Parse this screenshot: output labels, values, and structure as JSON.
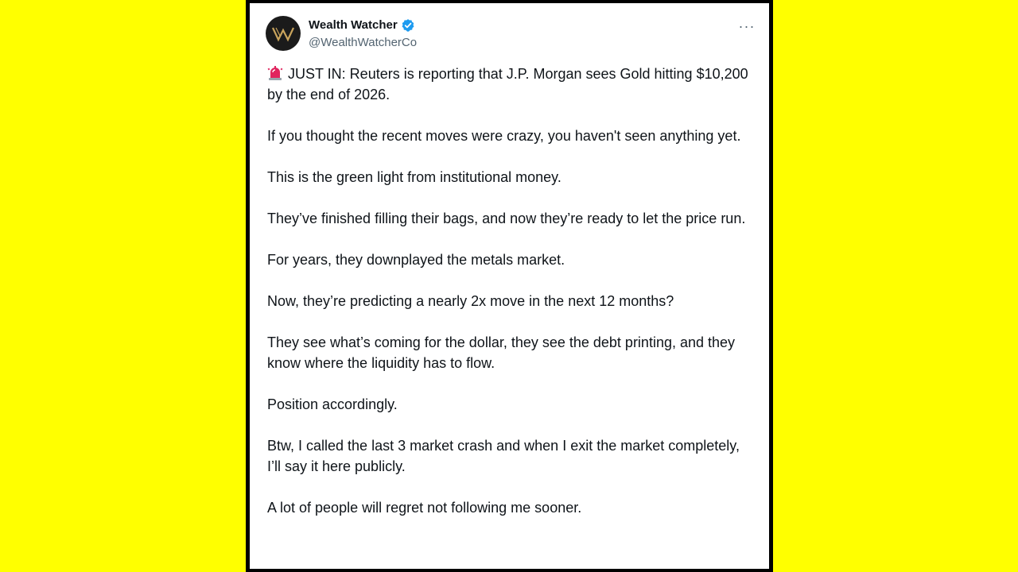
{
  "colors": {
    "background": "#ffff00",
    "frame": "#000000",
    "card": "#ffffff",
    "text": "#0f1419",
    "muted": "#536471",
    "verified": "#1d9bf0",
    "avatar_bg": "#1b1b1b",
    "avatar_logo": "#c9a45c"
  },
  "tweet": {
    "author": {
      "display_name": "Wealth Watcher",
      "handle": "@WealthWatcherCo",
      "avatar_icon": "ww-logo-icon",
      "verified_icon": "verified-badge-icon"
    },
    "more_icon": "more-options-icon",
    "more_label": "···",
    "lead_icon": "siren-icon",
    "paragraphs": [
      "JUST IN: Reuters is reporting that J.P. Morgan sees Gold hitting $10,200 by the end of 2026.",
      "If you thought the recent moves were crazy, you haven't seen anything yet.",
      "This is the green light from institutional money.",
      "They’ve finished filling their bags, and now they’re ready to let the price run.",
      "For years, they downplayed the metals market.",
      "Now, they’re predicting a nearly 2x move in the next 12 months?",
      "They see what’s coming for the dollar, they see the debt printing, and they know where the liquidity has to flow.",
      "Position accordingly.",
      "Btw, I called the last 3 market crash and when I exit the market completely, I’ll say it here publicly.",
      "A lot of people will regret not following me sooner."
    ]
  }
}
